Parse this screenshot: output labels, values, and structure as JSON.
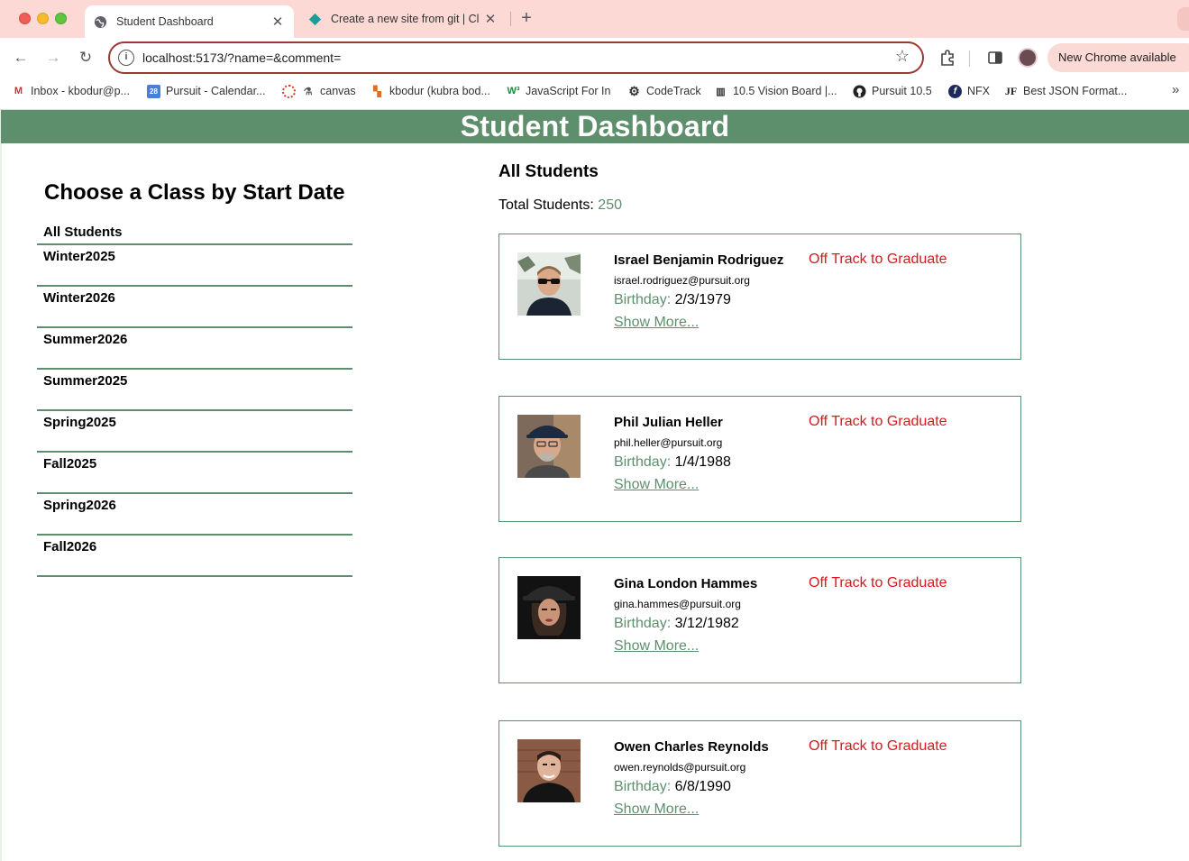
{
  "browser": {
    "tabs": [
      {
        "label": "Student Dashboard",
        "active": true
      },
      {
        "label": "Create a new site from git | Cl",
        "active": false
      }
    ],
    "url": "localhost:5173/?name=&comment=",
    "update_label": "New Chrome available",
    "bookmarks": [
      {
        "label": "Inbox - kbodur@p...",
        "icon": "gmail-icon"
      },
      {
        "label": "Pursuit - Calendar...",
        "icon": "calendar-icon"
      },
      {
        "label": "canvas",
        "icon": "canvas-icon"
      },
      {
        "label": "kbodur (kubra bod...",
        "icon": "gitlab-icon"
      },
      {
        "label": "JavaScript For In",
        "icon": "w3schools-icon"
      },
      {
        "label": "CodeTrack",
        "icon": "gear-icon"
      },
      {
        "label": "10.5 Vision Board |...",
        "icon": "board-icon"
      },
      {
        "label": "Pursuit 10.5",
        "icon": "github-icon"
      },
      {
        "label": "NFX",
        "icon": "nfx-icon"
      },
      {
        "label": "Best JSON Format...",
        "icon": "json-icon"
      }
    ]
  },
  "app": {
    "title": "Student Dashboard",
    "class_heading": "Choose a Class by Start Date",
    "classes": [
      "All Students",
      "Winter2025",
      "Winter2026",
      "Summer2026",
      "Summer2025",
      "Spring2025",
      "Fall2025",
      "Spring2026",
      "Fall2026"
    ],
    "section_title": "All Students",
    "total_label": "Total Students:",
    "total_count": "250",
    "students": [
      {
        "name": "Israel Benjamin Rodriguez",
        "email": "israel.rodriguez@pursuit.org",
        "birthday_label": "Birthday:",
        "birthday": "2/3/1979",
        "more": "Show More...",
        "status": "Off Track to Graduate"
      },
      {
        "name": "Phil Julian Heller",
        "email": "phil.heller@pursuit.org",
        "birthday_label": "Birthday:",
        "birthday": "1/4/1988",
        "more": "Show More...",
        "status": "Off Track to Graduate"
      },
      {
        "name": "Gina London Hammes",
        "email": "gina.hammes@pursuit.org",
        "birthday_label": "Birthday:",
        "birthday": "3/12/1982",
        "more": "Show More...",
        "status": "Off Track to Graduate"
      },
      {
        "name": "Owen Charles Reynolds",
        "email": "owen.reynolds@pursuit.org",
        "birthday_label": "Birthday:",
        "birthday": "6/8/1990",
        "more": "Show More...",
        "status": "Off Track to Graduate"
      }
    ]
  },
  "colors": {
    "accent_green": "#5e8f6c",
    "status_red": "#e0151b",
    "tabbar_pink": "#fcd9d5"
  }
}
